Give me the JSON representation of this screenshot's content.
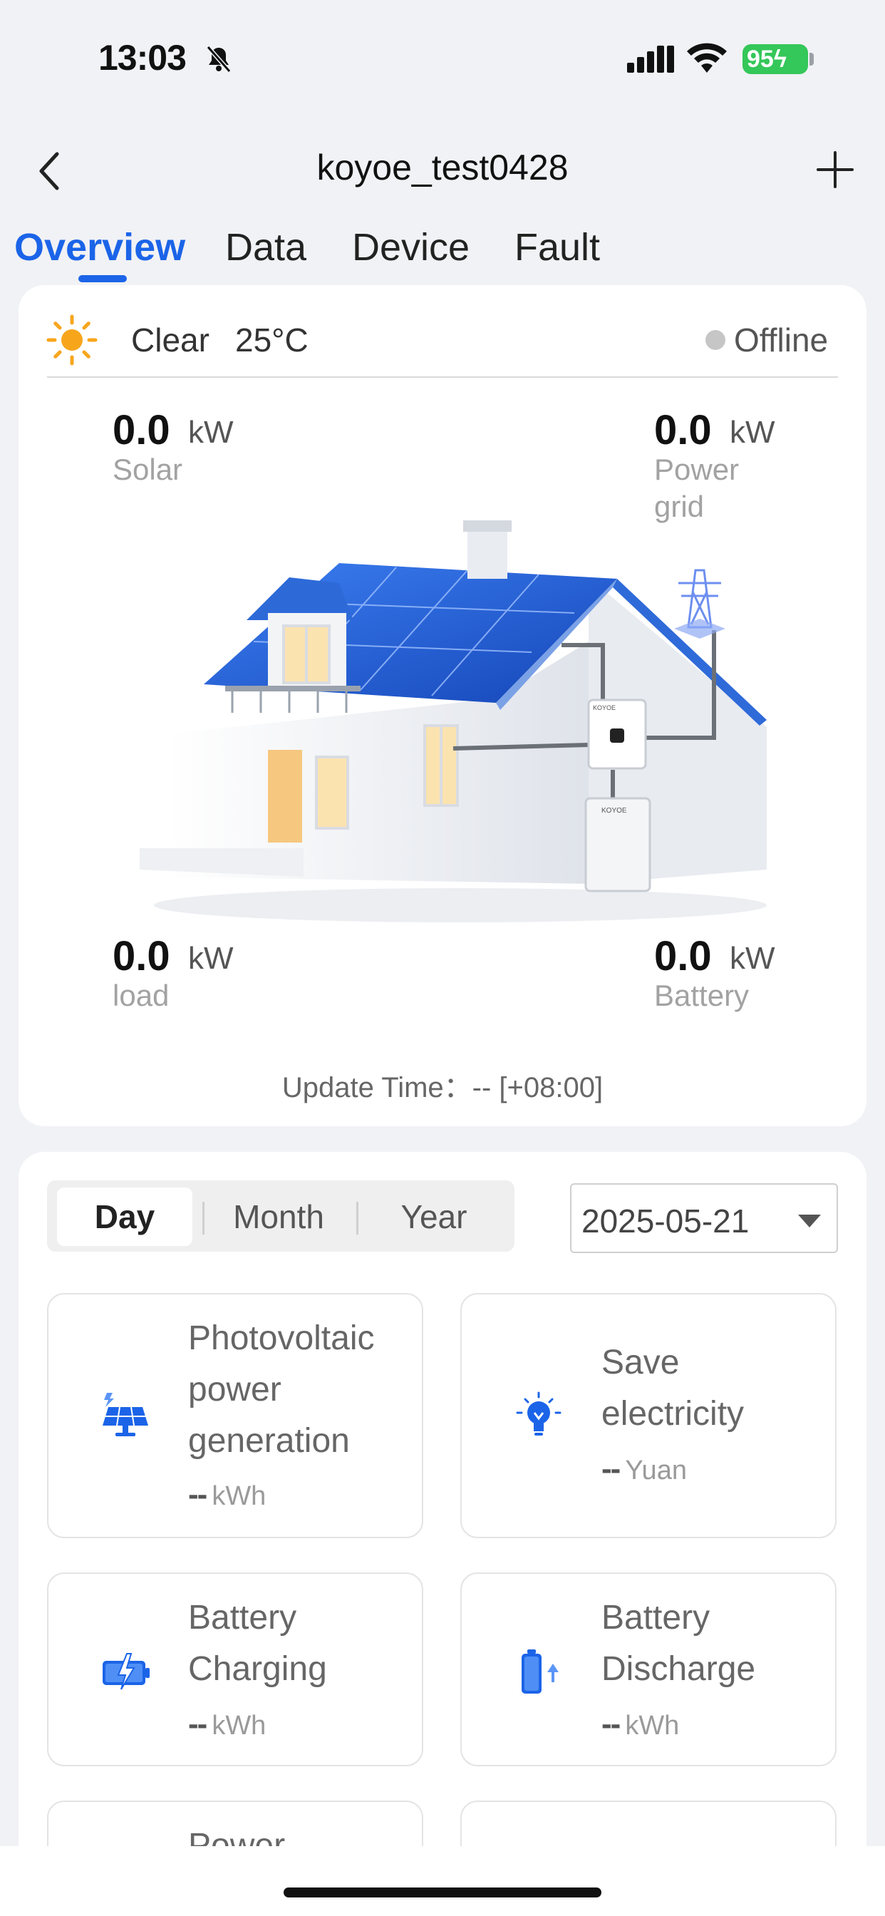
{
  "status_bar": {
    "time": "13:03",
    "battery": "95"
  },
  "nav": {
    "title": "koyoe_test0428"
  },
  "tabs": [
    {
      "label": "Overview"
    },
    {
      "label": "Data"
    },
    {
      "label": "Device"
    },
    {
      "label": "Fault"
    }
  ],
  "overview": {
    "weather": "Clear",
    "temperature": "25°C",
    "status": "Offline",
    "solar": {
      "value": "0.0",
      "unit": "kW",
      "label": "Solar"
    },
    "grid": {
      "value": "0.0",
      "unit": "kW",
      "label_line1": "Power",
      "label_line2": "grid"
    },
    "load": {
      "value": "0.0",
      "unit": "kW",
      "label": "load"
    },
    "battery": {
      "value": "0.0",
      "unit": "kW",
      "label": "Battery"
    },
    "update_time": "Update Time：-- [+08:00]",
    "device_brand": "KOYOE"
  },
  "stats": {
    "periods": [
      "Day",
      "Month",
      "Year"
    ],
    "selected_period": "Day",
    "date": "2025-05-21",
    "tiles": [
      {
        "icon": "solar-panel-icon",
        "title_lines": [
          "Photovoltaic",
          "power",
          "generation"
        ],
        "value": "--",
        "unit": "kWh"
      },
      {
        "icon": "lightbulb-icon",
        "title_lines": [
          "Save",
          "electricity"
        ],
        "value": "--",
        "unit": "Yuan"
      },
      {
        "icon": "battery-charging-icon",
        "title_lines": [
          "Battery",
          "Charging"
        ],
        "value": "--",
        "unit": "kWh"
      },
      {
        "icon": "battery-discharge-icon",
        "title_lines": [
          "Battery",
          "Discharge"
        ],
        "value": "--",
        "unit": "kWh"
      },
      {
        "icon": "power-icon",
        "title_lines": [
          "Power"
        ],
        "value": "",
        "unit": ""
      }
    ]
  },
  "colors": {
    "accent": "#1b64e8",
    "offline_dot": "#c6c6c6",
    "battery_green": "#34c759"
  }
}
